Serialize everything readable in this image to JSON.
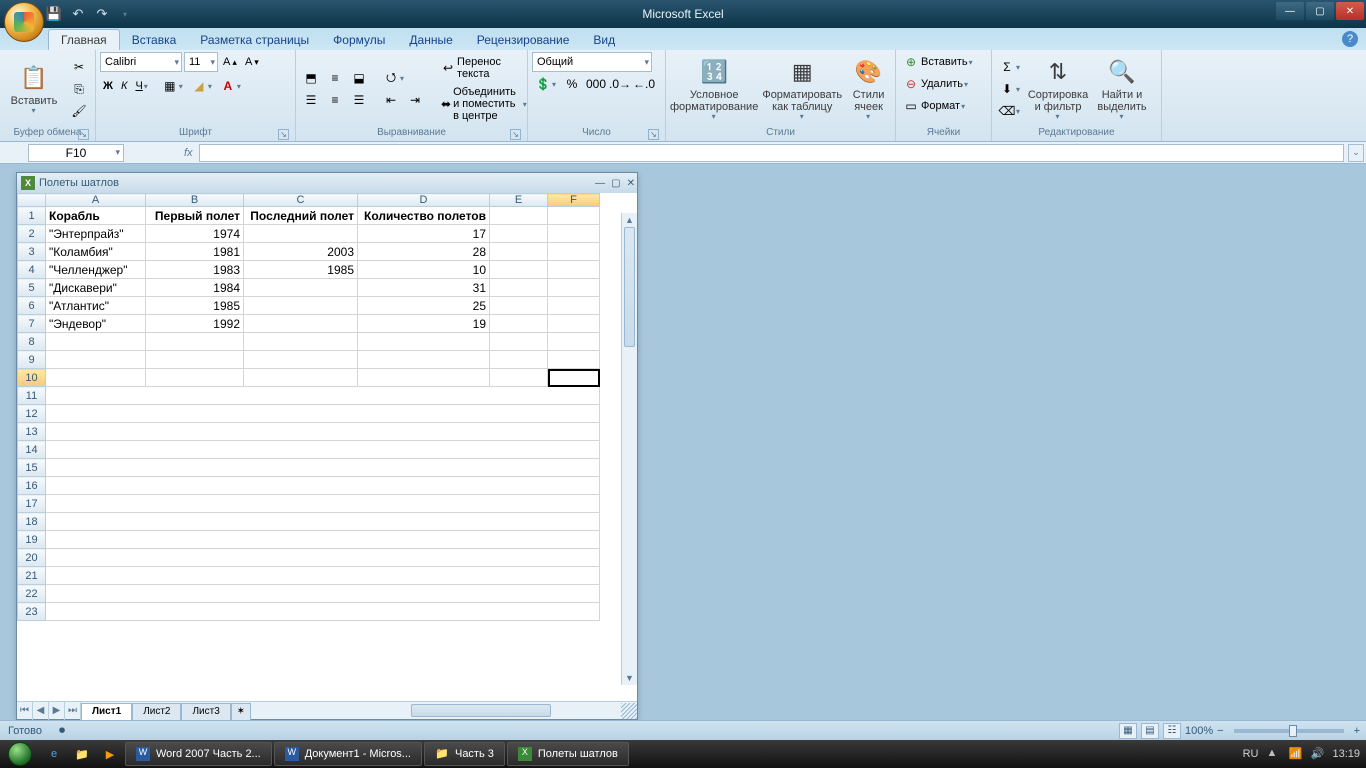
{
  "app_title": "Microsoft Excel",
  "qat": {
    "save": "💾",
    "undo": "↶",
    "redo": "↷"
  },
  "tabs": [
    "Главная",
    "Вставка",
    "Разметка страницы",
    "Формулы",
    "Данные",
    "Рецензирование",
    "Вид"
  ],
  "ribbon": {
    "clipboard": {
      "paste": "Вставить",
      "label": "Буфер обмена"
    },
    "font": {
      "name": "Calibri",
      "size": "11",
      "label": "Шрифт",
      "bold": "Ж",
      "italic": "К",
      "underline": "Ч"
    },
    "align": {
      "wrap": "Перенос текста",
      "merge": "Объединить и поместить в центре",
      "label": "Выравнивание"
    },
    "number": {
      "format": "Общий",
      "label": "Число"
    },
    "styles": {
      "cond": "Условное форматирование",
      "table": "Форматировать как таблицу",
      "cell": "Стили ячеек",
      "label": "Стили"
    },
    "cells": {
      "insert": "Вставить",
      "delete": "Удалить",
      "format": "Формат",
      "label": "Ячейки"
    },
    "editing": {
      "sort": "Сортировка и фильтр",
      "find": "Найти и выделить",
      "label": "Редактирование"
    }
  },
  "name_box": "F10",
  "child_window_title": "Полеты шатлов",
  "columns": [
    "A",
    "B",
    "C",
    "D",
    "E",
    "F"
  ],
  "active_cell": {
    "row": 10,
    "col": "F"
  },
  "sheet": {
    "headers": [
      "Корабль",
      "Первый полет",
      "Последний полет",
      "Количество полетов"
    ],
    "rows": [
      {
        "a": "\"Энтерпрайз\"",
        "b": "1974",
        "c": "",
        "d": "17"
      },
      {
        "a": "\"Коламбия\"",
        "b": "1981",
        "c": "2003",
        "d": "28"
      },
      {
        "a": "\"Челленджер\"",
        "b": "1983",
        "c": "1985",
        "d": "10"
      },
      {
        "a": "\"Дискавери\"",
        "b": "1984",
        "c": "",
        "d": "31"
      },
      {
        "a": "\"Атлантис\"",
        "b": "1985",
        "c": "",
        "d": "25"
      },
      {
        "a": "\"Эндевор\"",
        "b": "1992",
        "c": "",
        "d": "19"
      }
    ]
  },
  "sheet_tabs": [
    "Лист1",
    "Лист2",
    "Лист3"
  ],
  "status": {
    "ready": "Готово",
    "zoom": "100%"
  },
  "taskbar": {
    "tasks": [
      "Word 2007 Часть 2...",
      "Документ1 - Micros...",
      "Часть 3",
      "Полеты шатлов"
    ],
    "lang": "RU",
    "time": "13:19"
  }
}
